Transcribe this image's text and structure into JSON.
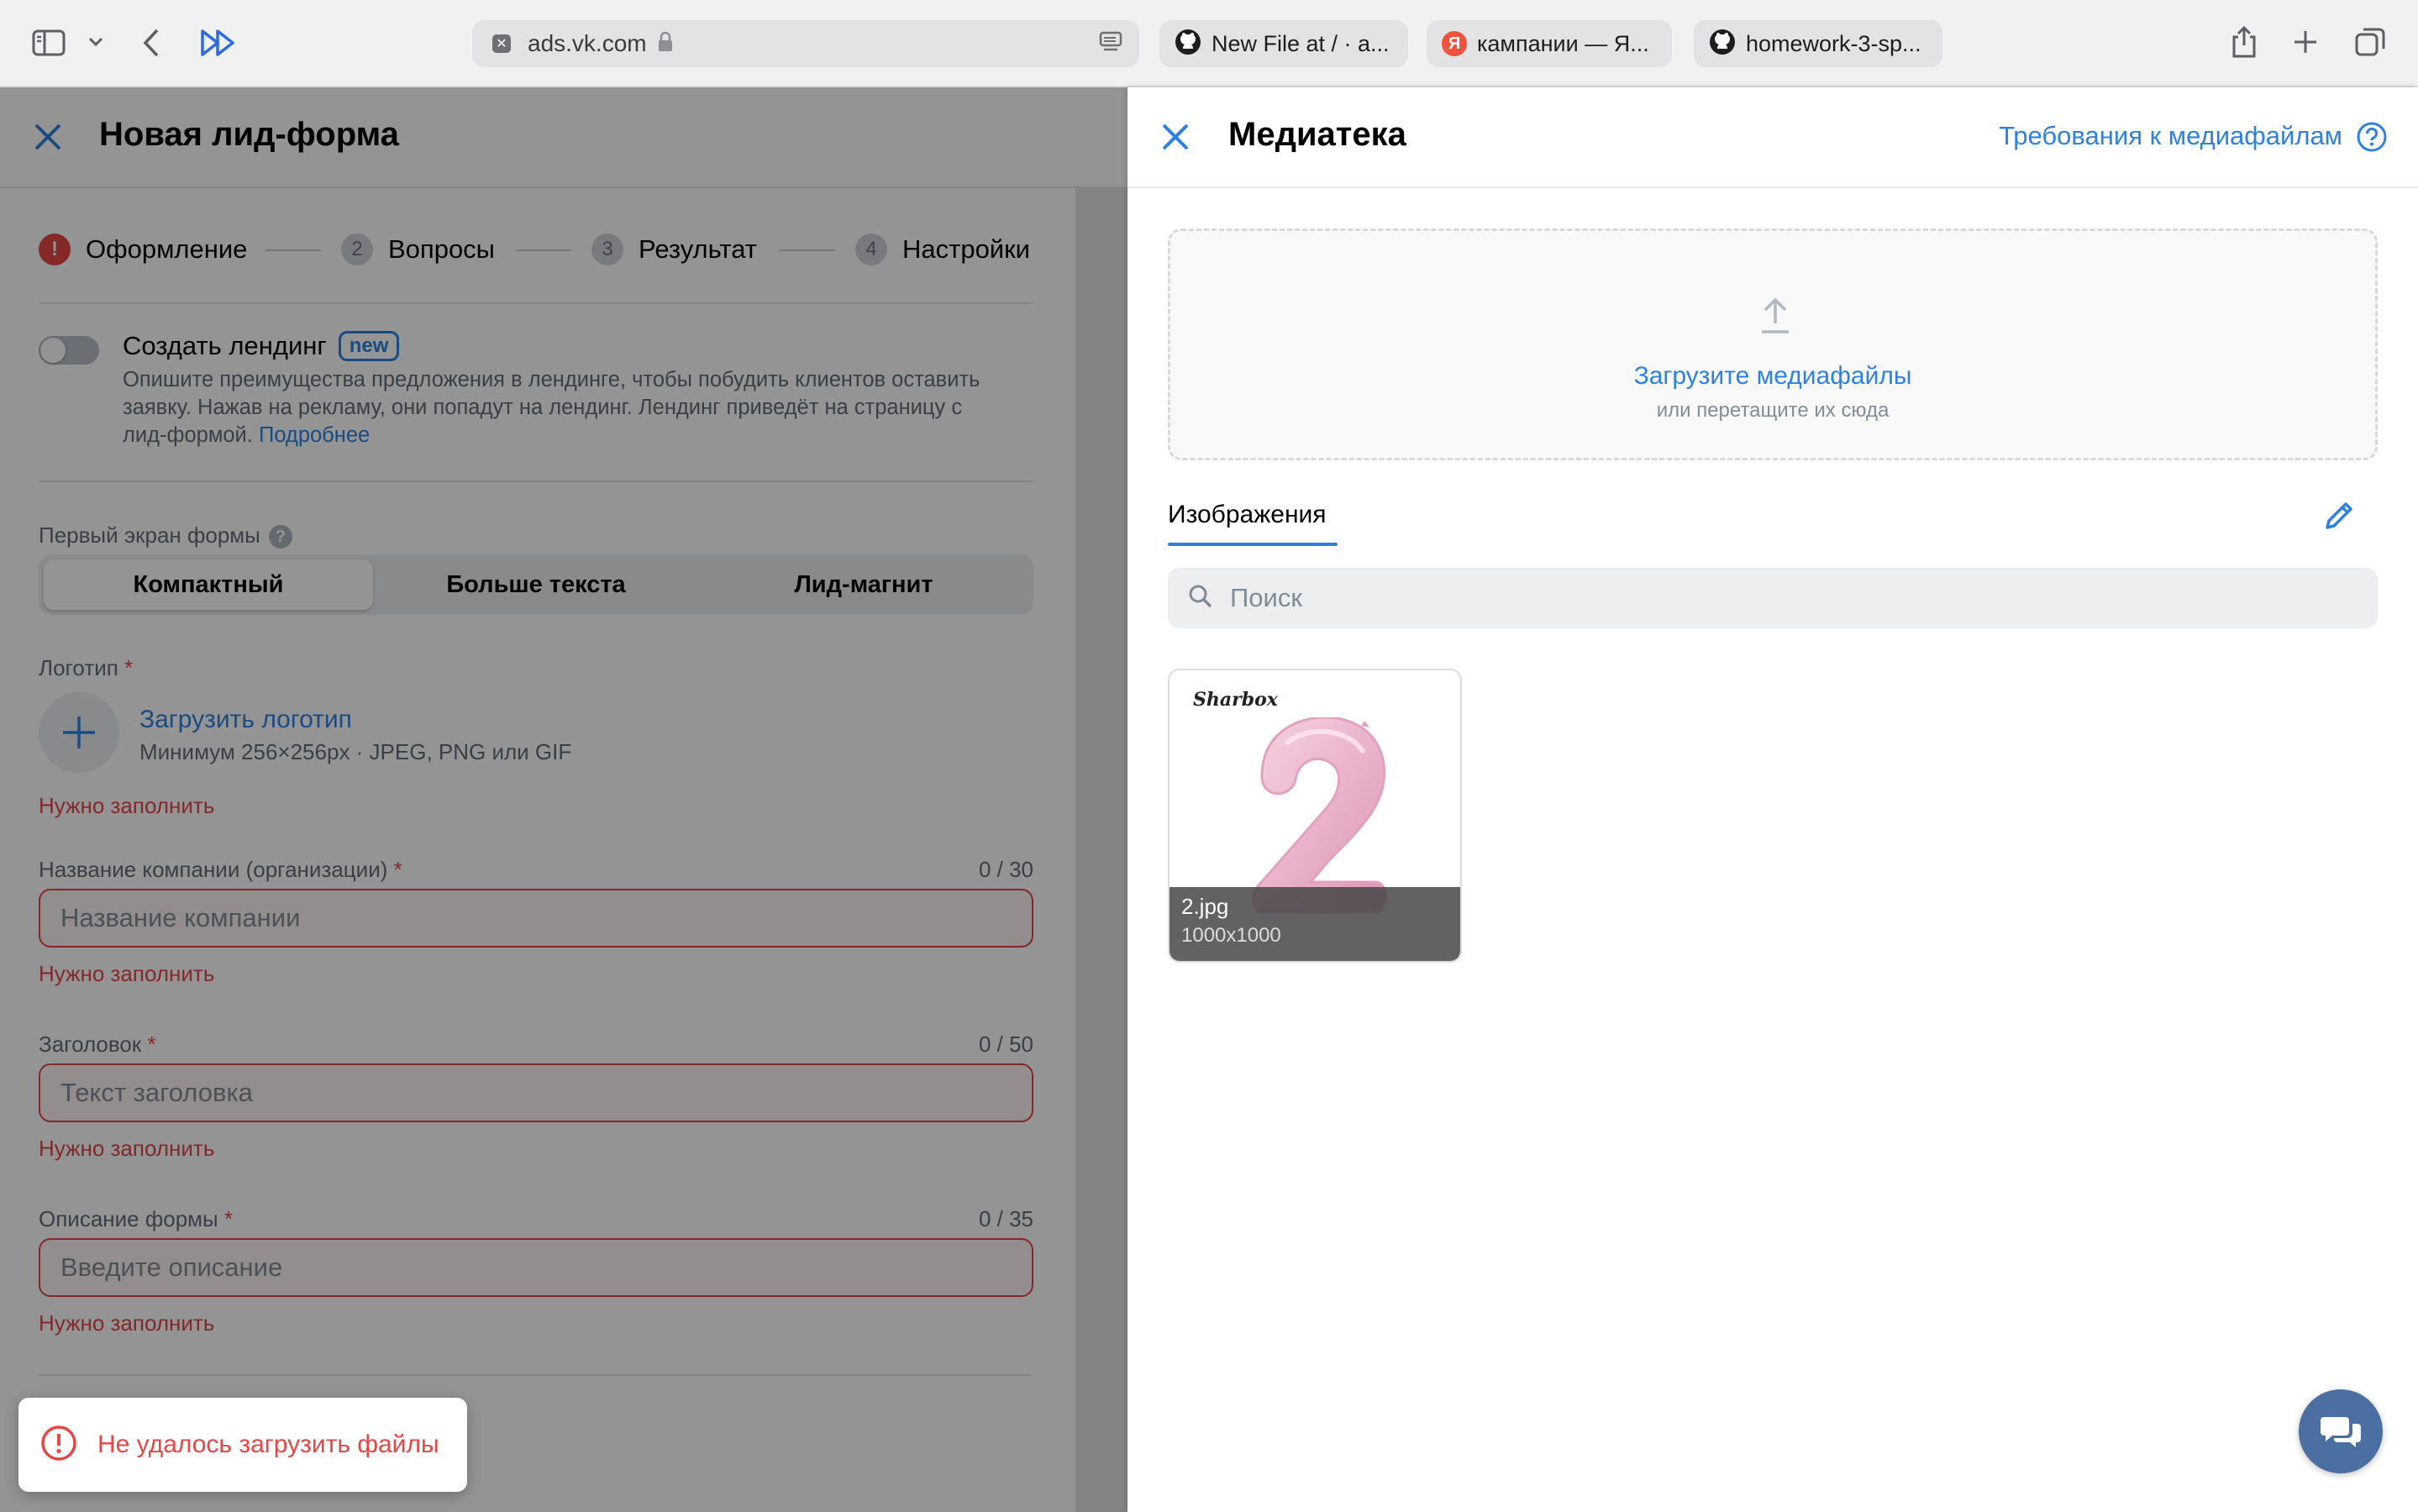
{
  "browser": {
    "address": "ads.vk.com",
    "tabs": [
      {
        "title": "New File at / · a..."
      },
      {
        "title": "кампании — Я..."
      },
      {
        "title": "homework-3-sp..."
      }
    ]
  },
  "left_panel": {
    "title": "Новая лид-форма",
    "steps": [
      {
        "number": "!",
        "label": "Оформление"
      },
      {
        "number": "2",
        "label": "Вопросы"
      },
      {
        "number": "3",
        "label": "Результат"
      },
      {
        "number": "4",
        "label": "Настройки"
      }
    ],
    "landing": {
      "title": "Создать лендинг",
      "badge": "new",
      "description": "Опишите преимущества предложения в лендинге, чтобы побудить клиентов оставить заявку. Нажав на рекламу, они попадут на лендинг. Лендинг приведёт на страницу с лид-формой.",
      "more_link": "Подробнее",
      "enabled": false
    },
    "first_screen": {
      "label": "Первый экран формы",
      "help": "?",
      "options": [
        "Компактный",
        "Больше текста",
        "Лид-магнит"
      ],
      "selected": "Компактный"
    },
    "logo": {
      "label": "Логотип",
      "required_mark": "*",
      "upload_link": "Загрузить логотип",
      "hint": "Минимум 256×256px · JPEG, PNG или GIF",
      "error": "Нужно заполнить"
    },
    "company": {
      "label": "Название компании (организации)",
      "required_mark": "*",
      "counter": "0 / 30",
      "placeholder": "Название компании",
      "error": "Нужно заполнить"
    },
    "heading": {
      "label": "Заголовок",
      "required_mark": "*",
      "counter": "0 / 50",
      "placeholder": "Текст заголовка",
      "error": "Нужно заполнить"
    },
    "description": {
      "label": "Описание формы",
      "required_mark": "*",
      "counter": "0 / 35",
      "placeholder": "Введите описание",
      "error": "Нужно заполнить"
    }
  },
  "toast": {
    "message": "Не удалось загрузить файлы"
  },
  "media_library": {
    "title": "Медиатека",
    "requirements_link": "Требования к медиафайлам",
    "upload": {
      "main": "Загрузите медиафайлы",
      "sub": "или перетащите их сюда"
    },
    "tab": "Изображения",
    "search_placeholder": "Поиск",
    "files": [
      {
        "name": "2.jpg",
        "size": "1000x1000",
        "brand": "Sharbox"
      }
    ]
  },
  "colors": {
    "accent": "#2d81e0",
    "error": "#e64646",
    "chat_button": "#4a6fa0"
  }
}
